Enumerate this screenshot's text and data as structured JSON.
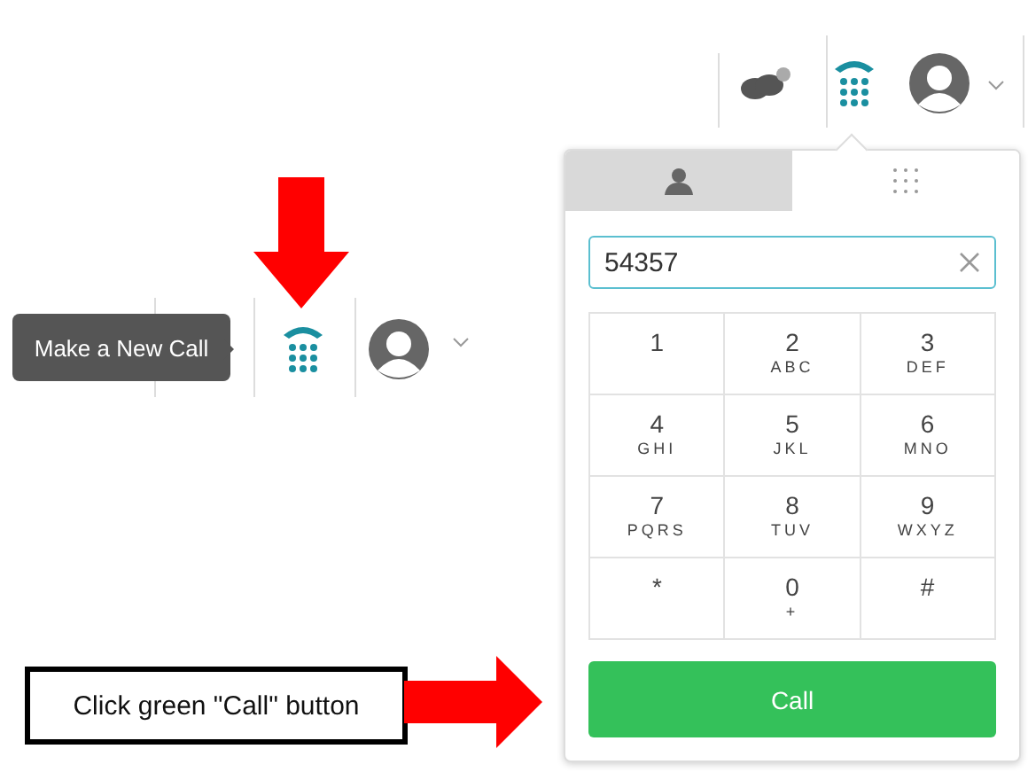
{
  "top_toolbar": {
    "items": [
      {
        "kind": "chat"
      },
      {
        "kind": "phone",
        "selected": true
      },
      {
        "kind": "avatar"
      }
    ]
  },
  "dialpad": {
    "tabs": [
      {
        "kind": "contacts",
        "selected": false
      },
      {
        "kind": "keypad",
        "selected": true
      }
    ],
    "number_field": {
      "value": "54357"
    },
    "keys": [
      {
        "digit": "1"
      },
      {
        "digit": "2",
        "letters": "ABC"
      },
      {
        "digit": "3",
        "letters": "DEF"
      },
      {
        "digit": "4",
        "letters": "GHI"
      },
      {
        "digit": "5",
        "letters": "JKL"
      },
      {
        "digit": "6",
        "letters": "MNO"
      },
      {
        "digit": "7",
        "letters": "PQRS"
      },
      {
        "digit": "8",
        "letters": "TUV"
      },
      {
        "digit": "9",
        "letters": "WXYZ"
      },
      {
        "digit": "*"
      },
      {
        "digit": "0",
        "letters": "+"
      },
      {
        "digit": "#"
      }
    ],
    "call_button": {
      "label": "Call"
    }
  },
  "left_toolbar": {
    "tooltip": "Make a New Call"
  },
  "annotation": {
    "text": "Click green \"Call\" button"
  }
}
